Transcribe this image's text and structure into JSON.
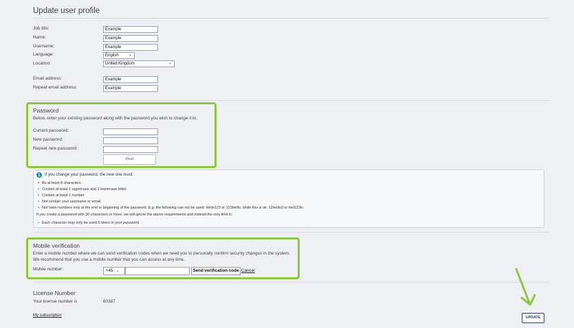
{
  "page_title": "Update user profile",
  "profile": {
    "job_title": {
      "label": "Job title:",
      "value": "Example"
    },
    "name": {
      "label": "Name:",
      "value": "Example"
    },
    "username": {
      "label": "Username:",
      "value": "Example"
    },
    "language": {
      "label": "Language:",
      "value": "English"
    },
    "location": {
      "label": "Location:",
      "value": "United Kingdom"
    },
    "email": {
      "label": "Email address:",
      "value": "Example"
    },
    "repeat_email": {
      "label": "Repeat email address:",
      "value": "Example"
    }
  },
  "password": {
    "title": "Password",
    "description": "Below, enter your existing password along with the password you wish to change it to.",
    "current_label": "Current password:",
    "new_label": "New password:",
    "repeat_label": "Repeat new password:",
    "strength_label": "Weak"
  },
  "rules": {
    "heading": "If you change your password, the new one must:",
    "items": [
      "Be at least 8 characters",
      "Contain at least 1 uppercase and 1 lowercase letter",
      "Contain at least 1 number",
      "Not contain your username or email",
      "Not have numbers only at the end or beginning of the password. E.g. the following can not be used: Hello123 or 123Hello, while this is ok: 12Hello3 or Hel123lo"
    ],
    "long_note": "If you create a password with 30 characters or more, we will ignore the above requirements and instead the only limit is:",
    "long_items": [
      "Each character may only be used 5 times in your password"
    ]
  },
  "mobile": {
    "title": "Mobile verification",
    "desc_line1": "Enter a mobile number where we can send verification codes when we need you to personally confirm security changes in the system.",
    "desc_line2": "We recommend that you use a mobile number that you can access at any time.",
    "number_label": "Mobile number:",
    "prefix": "+45",
    "send_label": "Send verification code",
    "cancel_label": "Cancel"
  },
  "license": {
    "title": "License Number",
    "label": "Your license number is",
    "value": "60387",
    "subscription_link": "My subscription"
  },
  "update_label": "UPDATE",
  "colors": {
    "highlight": "#8dc63f",
    "info_icon": "#1f8ad6",
    "button_border": "#2c3e62"
  }
}
